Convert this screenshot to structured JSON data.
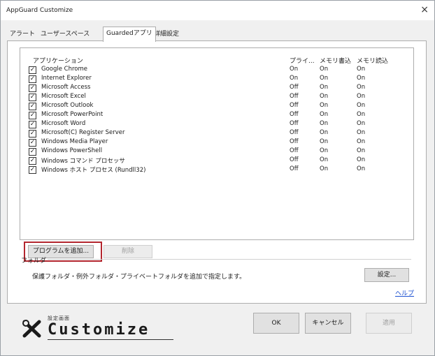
{
  "window": {
    "title": "AppGuard Customize",
    "close_label": "×"
  },
  "tabs": [
    {
      "label": "アラート",
      "active": false
    },
    {
      "label": "ユーザースペース",
      "active": false
    },
    {
      "label": "Guardedアプリ",
      "active": true
    },
    {
      "label": "詳細設定",
      "active": false
    }
  ],
  "list": {
    "columns": [
      "アプリケーション",
      "プライ...",
      "メモリ書込",
      "メモリ読込"
    ],
    "rows": [
      {
        "name": "Google Chrome",
        "checked": true,
        "private": "On",
        "mem_write": "On",
        "mem_read": "On"
      },
      {
        "name": "Internet Explorer",
        "checked": true,
        "private": "On",
        "mem_write": "On",
        "mem_read": "On"
      },
      {
        "name": "Microsoft Access",
        "checked": true,
        "private": "Off",
        "mem_write": "On",
        "mem_read": "On"
      },
      {
        "name": "Microsoft Excel",
        "checked": true,
        "private": "Off",
        "mem_write": "On",
        "mem_read": "On"
      },
      {
        "name": "Microsoft Outlook",
        "checked": true,
        "private": "Off",
        "mem_write": "On",
        "mem_read": "On"
      },
      {
        "name": "Microsoft PowerPoint",
        "checked": true,
        "private": "Off",
        "mem_write": "On",
        "mem_read": "On"
      },
      {
        "name": "Microsoft Word",
        "checked": true,
        "private": "Off",
        "mem_write": "On",
        "mem_read": "On"
      },
      {
        "name": "Microsoft(C) Register Server",
        "checked": true,
        "private": "Off",
        "mem_write": "On",
        "mem_read": "On"
      },
      {
        "name": "Windows Media Player",
        "checked": true,
        "private": "Off",
        "mem_write": "On",
        "mem_read": "On"
      },
      {
        "name": "Windows PowerShell",
        "checked": true,
        "private": "Off",
        "mem_write": "On",
        "mem_read": "On"
      },
      {
        "name": "Windows コマンド プロセッサ",
        "checked": true,
        "private": "Off",
        "mem_write": "On",
        "mem_read": "On"
      },
      {
        "name": "Windows ホスト プロセス (Rundll32)",
        "checked": true,
        "private": "Off",
        "mem_write": "On",
        "mem_read": "On"
      }
    ],
    "check_glyph": "✓"
  },
  "buttons": {
    "add_program": "プログラムを追加...",
    "delete": "削除",
    "settings": "設定...",
    "ok": "OK",
    "cancel": "キャンセル",
    "apply": "適用"
  },
  "folder": {
    "label": "フォルダ",
    "description": "保護フォルダ・例外フォルダ・プライベートフォルダを追加で指定します。",
    "help_link": "ヘルプ"
  },
  "logo": {
    "subtitle": "設定画面",
    "text": "Customize",
    "icon": "tools-icon"
  },
  "colors": {
    "highlight": "#b3262e",
    "link": "#1a4fd0"
  }
}
